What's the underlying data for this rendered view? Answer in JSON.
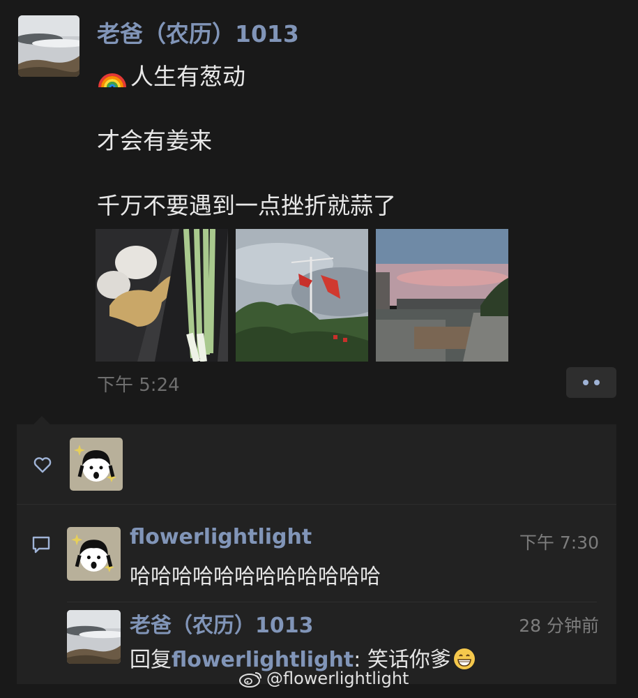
{
  "post": {
    "author": "老爸（农历）1013",
    "lines": [
      "人生有葱动",
      "才会有姜来",
      "千万不要遇到一点挫折就蒜了"
    ],
    "emoji_icon": "rainbow-icon",
    "timestamp": "下午 5:24",
    "photos": [
      "garlic-ginger-scallion-photo",
      "flagpole-flags-photo",
      "sunset-river-photo"
    ]
  },
  "likes": {
    "icon": "heart-icon",
    "avatars": [
      "cartoon-girl-avatar"
    ]
  },
  "comments": [
    {
      "name": "flowerlightlight",
      "time": "下午 7:30",
      "text": "哈哈哈哈哈哈哈哈哈哈哈哈"
    },
    {
      "name": "老爸（农历）1013",
      "time": "28 分钟前",
      "reply_prefix": "回复",
      "reply_to": "flowerlightlight",
      "reply_sep": ": ",
      "text": "笑话你爹",
      "emoji_icon": "grinning-face-icon"
    }
  ],
  "watermark": "@flowerlightlight",
  "colors": {
    "background": "#191919",
    "panel": "#222222",
    "name_blue": "#8195b8"
  }
}
